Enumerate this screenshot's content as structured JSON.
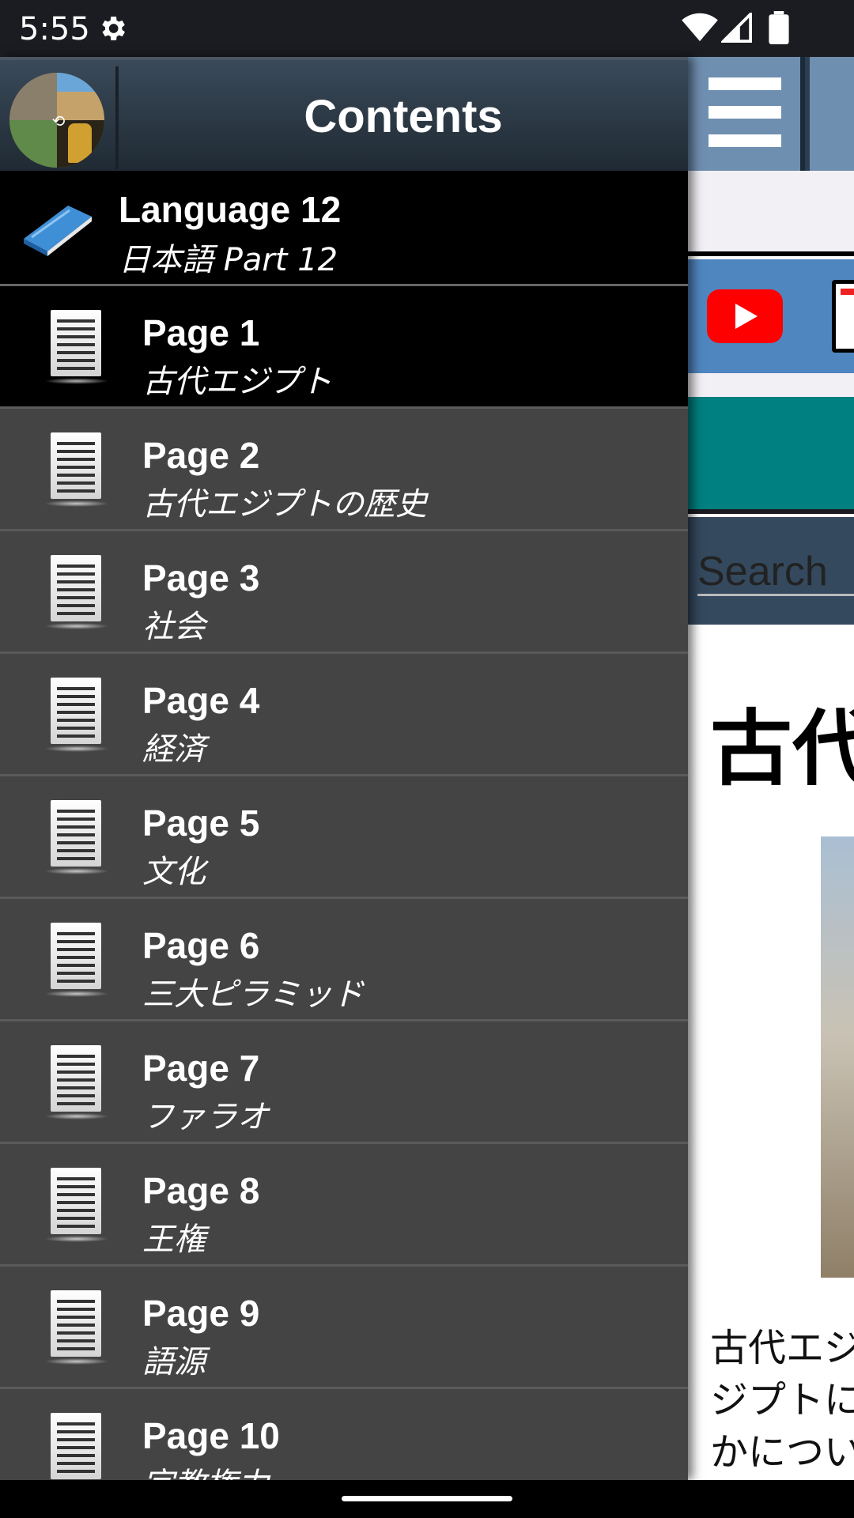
{
  "status_bar": {
    "time": "5:55",
    "icons": [
      "gear-icon",
      "wifi-icon",
      "signal-icon",
      "battery-icon"
    ]
  },
  "drawer": {
    "title": "Contents",
    "book": {
      "title": "Language 12",
      "subtitle": "日本語 Part 12"
    },
    "pages": [
      {
        "label": "Page 1",
        "subtitle": "古代エジプト",
        "selected": true
      },
      {
        "label": "Page 2",
        "subtitle": "古代エジプトの歴史"
      },
      {
        "label": "Page 3",
        "subtitle": "社会"
      },
      {
        "label": "Page 4",
        "subtitle": "経済"
      },
      {
        "label": "Page 5",
        "subtitle": "文化"
      },
      {
        "label": "Page 6",
        "subtitle": "三大ピラミッド"
      },
      {
        "label": "Page 7",
        "subtitle": "ファラオ"
      },
      {
        "label": "Page 8",
        "subtitle": "王権"
      },
      {
        "label": "Page 9",
        "subtitle": "語源"
      },
      {
        "label": "Page 10",
        "subtitle": "宗教権力"
      }
    ]
  },
  "content": {
    "search_placeholder": "Search",
    "heading": "古代",
    "body_lines": [
      "古代エジ",
      "ジプトに",
      "かについ"
    ]
  },
  "colors": {
    "drawer_bg": "#444444",
    "selected_bg": "#000000",
    "toolbar_blue": "#6f8fb0",
    "teal": "#008080",
    "youtube_red": "#ff0000"
  }
}
